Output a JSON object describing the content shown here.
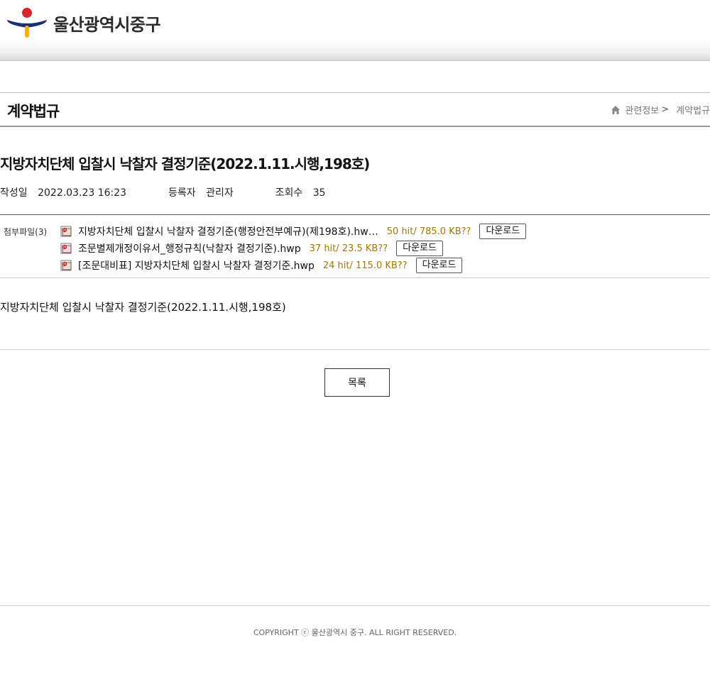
{
  "header": {
    "logo_text": "울산광역시중구",
    "logo_colors": {
      "red": "#d9262d",
      "navy": "#1b2f74",
      "yellow": "#f1b40d"
    }
  },
  "title_bar": {
    "page_title": "계약법규",
    "breadcrumb": {
      "parent": "관련정보",
      "separator": ">",
      "current": "계약법규"
    }
  },
  "post": {
    "title": "지방자치단체 입찰시 낙찰자 결정기준(2022.1.11.시행,198호)",
    "meta": {
      "date_label": "작성일",
      "date_value": "2022.03.23 16:23",
      "author_label": "등록자",
      "author_value": "관리자",
      "views_label": "조회수",
      "views_value": "35"
    },
    "attachments": {
      "label": "첨부파일(3)",
      "files": [
        {
          "name": "지방자치단체 입찰시 낙찰자 결정기준(행정안전부예규)(제198호).hw…",
          "meta": "50 hit/ 785.0 KB??",
          "button": "다운로드"
        },
        {
          "name": "조문별제개정이유서_행정규칙(낙찰자 결정기준).hwp",
          "meta": "37 hit/ 23.5 KB??",
          "button": "다운로드"
        },
        {
          "name": "[조문대비표] 지방자치단체 입찰시 낙찰자 결정기준.hwp",
          "meta": "24 hit/ 115.0 KB??",
          "button": "다운로드"
        }
      ]
    },
    "content": "지방자치단체 입찰시 낙찰자 결정기준(2022.1.11.시행,198호)"
  },
  "actions": {
    "list_button": "목록"
  },
  "footer": {
    "copyright": "COPYRIGHT ⓒ 울산광역시 중구. ALL RIGHT RESERVED."
  }
}
